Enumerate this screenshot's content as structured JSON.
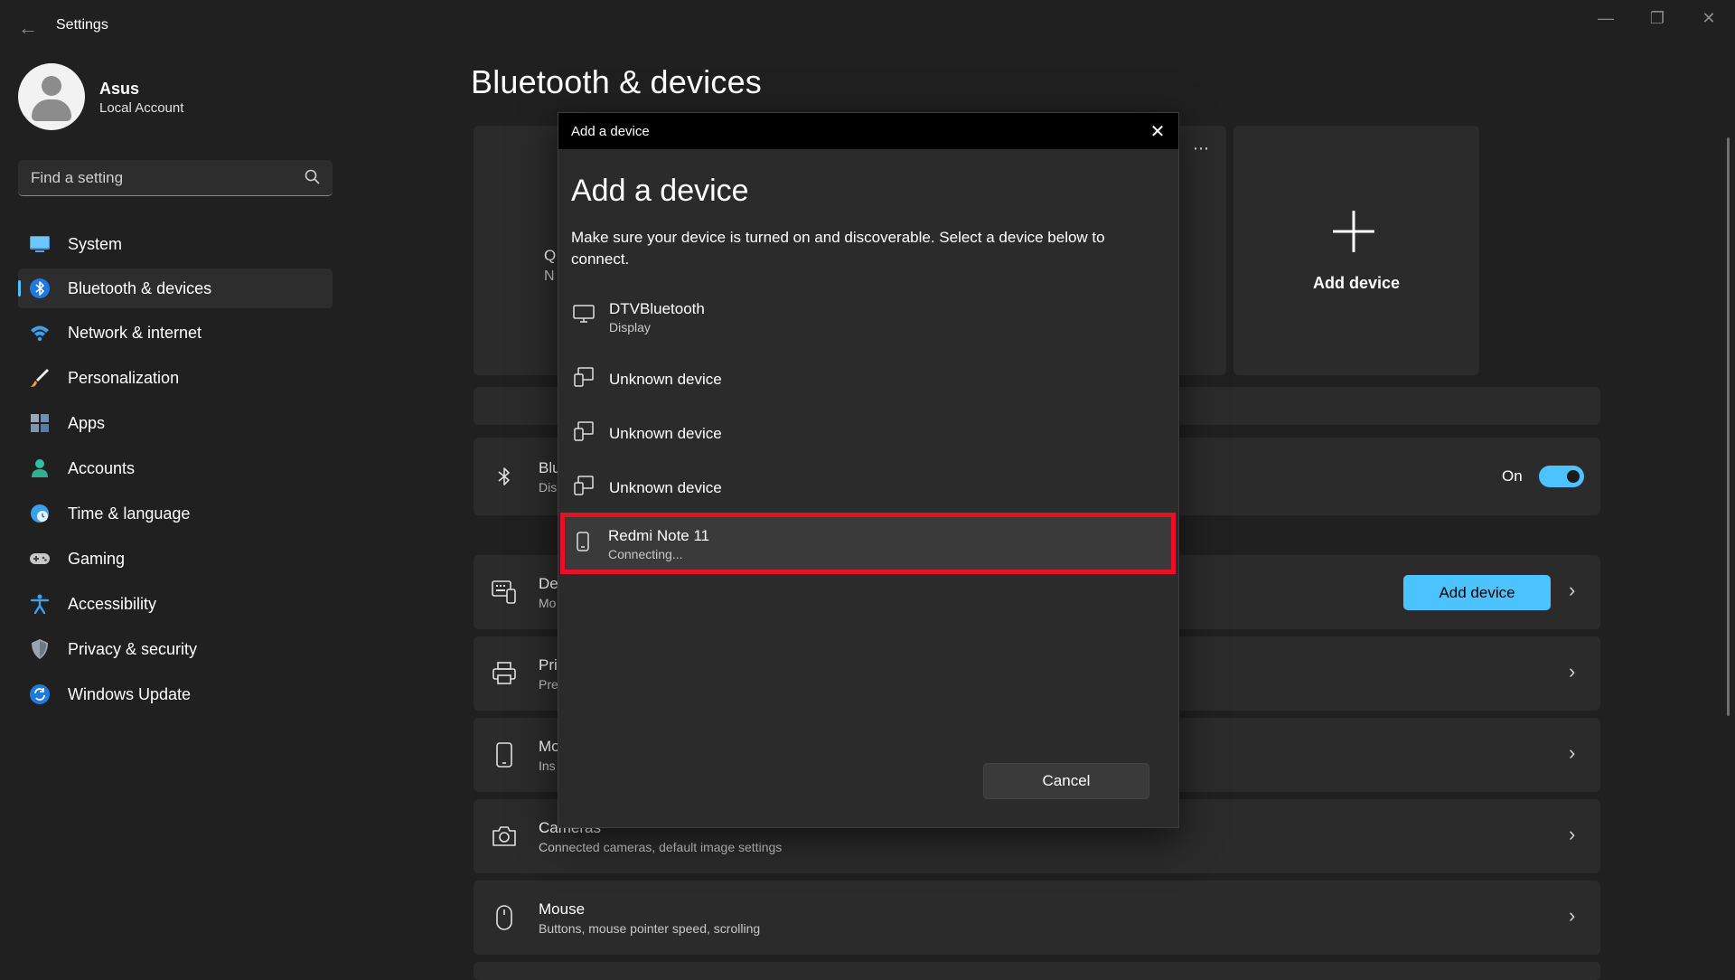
{
  "window": {
    "title": "Settings"
  },
  "profile": {
    "name": "Asus",
    "account_type": "Local Account"
  },
  "search": {
    "placeholder": "Find a setting"
  },
  "sidebar": {
    "items": [
      {
        "label": "System",
        "icon": "monitor-icon"
      },
      {
        "label": "Bluetooth & devices",
        "icon": "bluetooth-icon",
        "active": true
      },
      {
        "label": "Network & internet",
        "icon": "wifi-icon"
      },
      {
        "label": "Personalization",
        "icon": "brush-icon"
      },
      {
        "label": "Apps",
        "icon": "apps-icon"
      },
      {
        "label": "Accounts",
        "icon": "person-icon"
      },
      {
        "label": "Time & language",
        "icon": "clock-globe-icon"
      },
      {
        "label": "Gaming",
        "icon": "gamepad-icon"
      },
      {
        "label": "Accessibility",
        "icon": "accessibility-icon"
      },
      {
        "label": "Privacy & security",
        "icon": "shield-icon"
      },
      {
        "label": "Windows Update",
        "icon": "update-icon"
      }
    ]
  },
  "main": {
    "title": "Bluetooth & devices",
    "top_card_fragment": {
      "line1": "Q",
      "line2": "N"
    },
    "add_device_tile": {
      "label": "Add device"
    },
    "bluetooth_row": {
      "title_fragment": "Blu",
      "sub_fragment": "Dis",
      "toggle_label": "On",
      "toggle_on": true
    },
    "rows": [
      {
        "title_fragment": "De",
        "sub_fragment": "Mo",
        "icon": "keyboard-device-icon",
        "button": "Add device"
      },
      {
        "title_fragment": "Pri",
        "sub_fragment": "Pre",
        "icon": "printer-icon"
      },
      {
        "title_fragment": "Mo",
        "sub_fragment": "Ins",
        "icon": "phone-icon"
      },
      {
        "title": "Cameras",
        "subtitle": "Connected cameras, default image settings",
        "icon": "camera-icon"
      },
      {
        "title": "Mouse",
        "subtitle": "Buttons, mouse pointer speed, scrolling",
        "icon": "mouse-icon"
      }
    ]
  },
  "dialog": {
    "bar_title": "Add a device",
    "heading": "Add a device",
    "description": "Make sure your device is turned on and discoverable. Select a device below to connect.",
    "devices": [
      {
        "name": "DTVBluetooth",
        "type": "Display",
        "icon": "monitor-icon"
      },
      {
        "name": "Unknown device",
        "icon": "unknown-device-icon"
      },
      {
        "name": "Unknown device",
        "icon": "unknown-device-icon"
      },
      {
        "name": "Unknown device",
        "icon": "unknown-device-icon"
      },
      {
        "name": "Redmi Note 11",
        "status": "Connecting...",
        "icon": "phone-icon",
        "highlighted": true
      }
    ],
    "cancel_label": "Cancel"
  },
  "colors": {
    "accent": "#4cc2ff",
    "highlight": "#e81123",
    "background": "#202020",
    "card": "#2b2b2b"
  }
}
